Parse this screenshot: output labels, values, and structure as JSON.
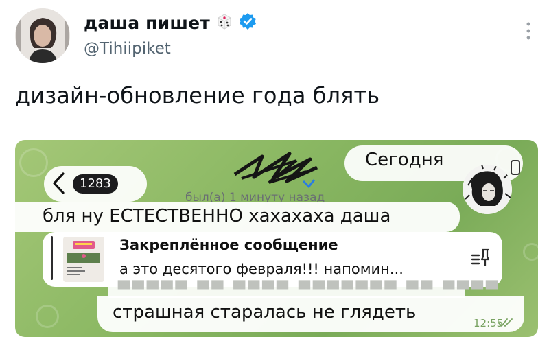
{
  "tweet": {
    "display_name": "даша пишет",
    "handle": "@Tihiipiket",
    "text": "дизайн-обновление года блять",
    "name_emoji": "die-icon",
    "verified_color": "#1d9bf0"
  },
  "telegram": {
    "date_chip": "Сегодня",
    "unread_count": "1283",
    "last_seen": "был(а) 1 минуту назад",
    "message_1": "бля ну ЕСТЕСТВЕННО хахахаха даша",
    "pinned": {
      "title": "Закреплённое сообщение",
      "preview": "а это десятого февраля!!! напомин..."
    },
    "message_last": "страшная старалась не глядеть",
    "message_time": "12:55",
    "accent_green": "#7aab58"
  }
}
